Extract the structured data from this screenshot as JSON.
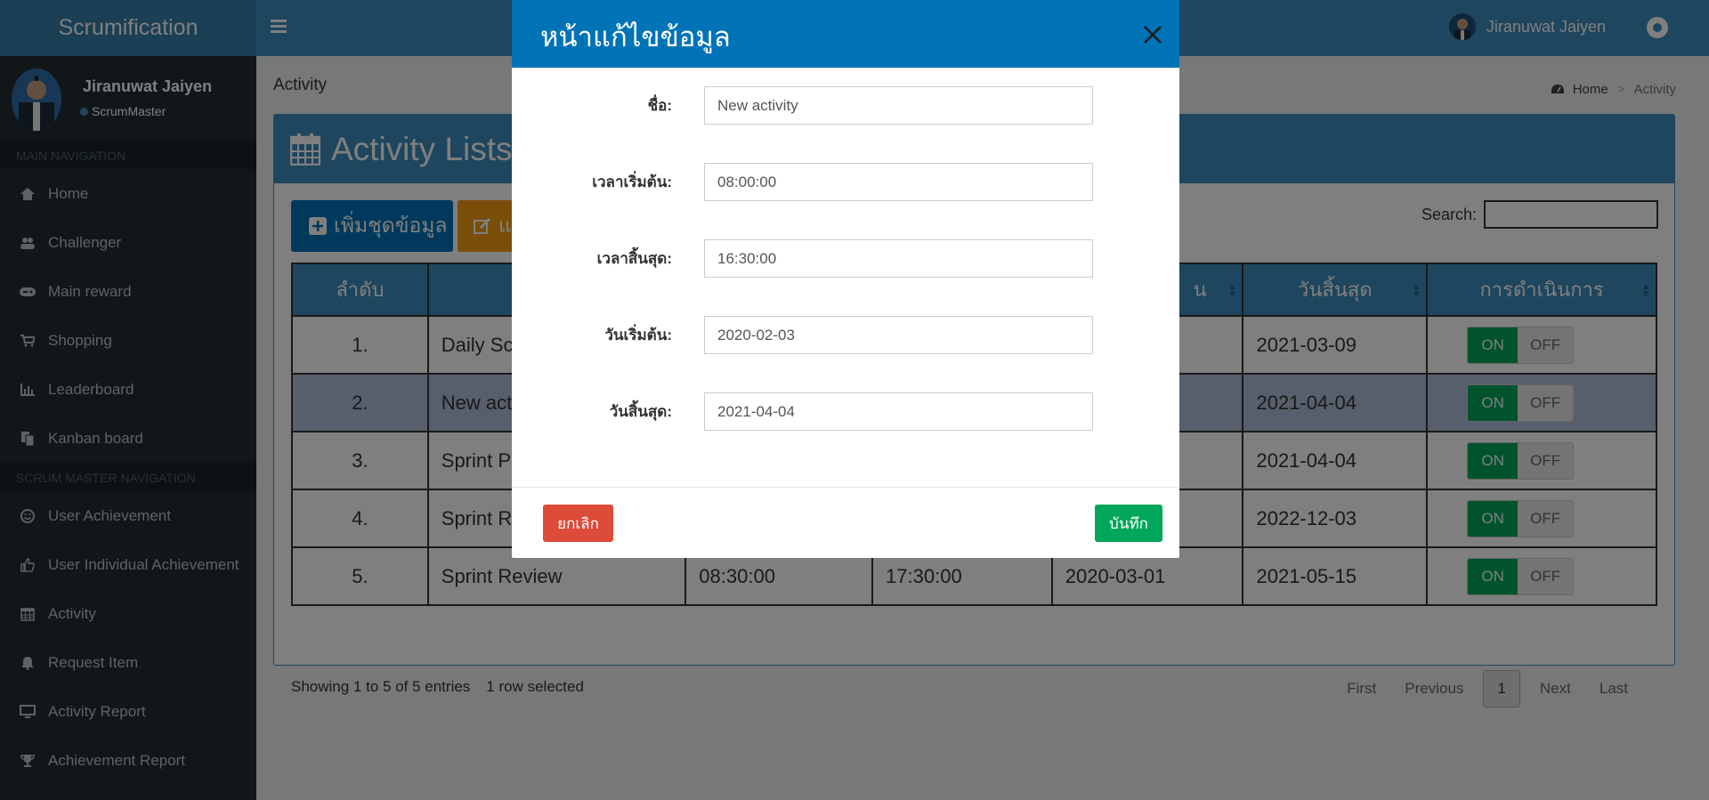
{
  "app": {
    "logo": "Scrumification"
  },
  "header": {
    "user_name": "Jiranuwat Jaiyen"
  },
  "sidebar": {
    "user": {
      "name": "Jiranuwat Jaiyen",
      "role": "ScrumMaster"
    },
    "main_header": "MAIN NAVIGATION",
    "main_items": [
      {
        "label": "Home",
        "icon": "home-icon"
      },
      {
        "label": "Challenger",
        "icon": "users-icon"
      },
      {
        "label": "Main reward",
        "icon": "gamepad-icon"
      },
      {
        "label": "Shopping",
        "icon": "cart-icon"
      },
      {
        "label": "Leaderboard",
        "icon": "bar-chart-icon"
      },
      {
        "label": "Kanban board",
        "icon": "files-icon"
      }
    ],
    "scrum_header": "SCRUM MASTER NAVIGATION",
    "scrum_items": [
      {
        "label": "User Achievement",
        "icon": "smile-icon"
      },
      {
        "label": "User Individual Achievement",
        "icon": "thumbs-up-icon"
      },
      {
        "label": "Activity",
        "icon": "calendar-icon"
      },
      {
        "label": "Request Item",
        "icon": "bell-icon"
      },
      {
        "label": "Activity Report",
        "icon": "monitor-icon"
      },
      {
        "label": "Achievement Report",
        "icon": "trophy-icon"
      }
    ]
  },
  "page": {
    "title": "Activity",
    "breadcrumb": [
      "Home",
      "Activity"
    ],
    "box_title": "Activity Lists",
    "add_button": "เพิ่มชุดข้อมูล",
    "edit_button": "แ",
    "search_label": "Search:"
  },
  "table": {
    "headers": [
      "ลำดับ",
      "",
      "",
      "",
      "น",
      "วันสิ้นสุด",
      "การดำเนินการ"
    ],
    "rows": [
      {
        "no": "1.",
        "name": "Daily Sc",
        "start_time": "",
        "end_time": "",
        "start_date": "",
        "end_date": "2021-03-09"
      },
      {
        "no": "2.",
        "name": "New act",
        "start_time": "",
        "end_time": "",
        "start_date": "",
        "end_date": "2021-04-04"
      },
      {
        "no": "3.",
        "name": "Sprint P",
        "start_time": "",
        "end_time": "",
        "start_date": "",
        "end_date": "2021-04-04"
      },
      {
        "no": "4.",
        "name": "Sprint R",
        "start_time": "",
        "end_time": "",
        "start_date": "",
        "end_date": "2022-12-03"
      },
      {
        "no": "5.",
        "name": "Sprint Review",
        "start_time": "08:30:00",
        "end_time": "17:30:00",
        "start_date": "2020-03-01",
        "end_date": "2021-05-15"
      }
    ],
    "toggle_on": "ON",
    "toggle_off": "OFF",
    "info": "Showing 1 to 5 of 5 entries",
    "selected": "1 row selected",
    "pager": {
      "first": "First",
      "previous": "Previous",
      "current": "1",
      "next": "Next",
      "last": "Last"
    }
  },
  "modal": {
    "title": "หน้าแก้ไขข้อมูล",
    "fields": [
      {
        "label": "ชื่อ:",
        "value": "New activity"
      },
      {
        "label": "เวลาเริ่มต้น:",
        "value": "08:00:00"
      },
      {
        "label": "เวลาสิ้นสุด:",
        "value": "16:30:00"
      },
      {
        "label": "วันเริ่มต้น:",
        "value": "2020-02-03"
      },
      {
        "label": "วันสิ้นสุด:",
        "value": "2021-04-04"
      }
    ],
    "cancel": "ยกเลิก",
    "save": "บันทึก"
  },
  "colors": {
    "primary": "#3c8dbc",
    "sidebar": "#222d32",
    "success": "#00a65a",
    "danger": "#dd4b39",
    "warning": "#f39c12",
    "modal_header": "#0073b7"
  }
}
